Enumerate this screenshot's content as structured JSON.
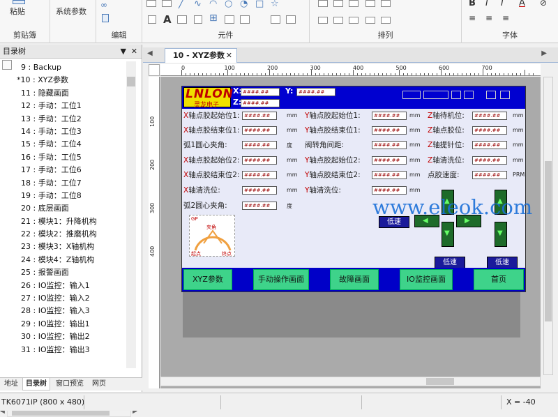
{
  "ribbon": {
    "paste_label": "粘贴",
    "clipboard_label": "剪贴簿",
    "system_params_label": "系统参数",
    "edit_label": "编辑",
    "elements_label": "元件",
    "arrange_label": "排列",
    "font_label": "字体",
    "text_tool": "A"
  },
  "tree_panel": {
    "title": "目录树",
    "items": [
      "9 : Backup",
      "*10 : XYZ参数",
      "11 : 隐藏画面",
      "12 : 手动：工位1",
      "13 : 手动：工位2",
      "14 : 手动：工位3",
      "15 : 手动：工位4",
      "16 : 手动：工位5",
      "17 : 手动：工位6",
      "18 : 手动：工位7",
      "19 : 手动：工位8",
      "20 : 底层画面",
      "21 : 模块1：升降机构",
      "22 : 模块2：推磨机构",
      "23 : 模块3：X轴机构",
      "24 : 模块4：Z轴机构",
      "25 : 报警画面",
      "26 : IO监控：输入1",
      "27 : IO监控：输入2",
      "28 : IO监控：输入3",
      "29 : IO监控：输出1",
      "30 : IO监控：输出2",
      "31 : IO监控：输出3"
    ],
    "bottom_tabs": [
      "地址",
      "目录树",
      "窗口预览",
      "网页"
    ]
  },
  "editor": {
    "tab_title": "10 - XYZ参数",
    "ruler_h": [
      "0",
      "100",
      "200",
      "300",
      "400",
      "500",
      "600",
      "700"
    ],
    "ruler_v": [
      "100",
      "200",
      "300",
      "400"
    ]
  },
  "hmi": {
    "logo": "LNLON",
    "logo_sub": "灵龙电子",
    "top_axes": [
      "X:",
      "Y:",
      "Z:"
    ],
    "field_value": "####.##",
    "rows_col1": [
      "X轴点胶起始位1:",
      "X轴点胶结束位1:",
      "弧1圆心夹角:",
      "X轴点胶起始位2:",
      "X轴点胶结束位2:",
      "X轴清洗位:",
      "弧2圆心夹角:"
    ],
    "rows_col2": [
      "Y轴点胶起始位1:",
      "Y轴点胶结束位1:",
      "阀转角间距:",
      "Y轴点胶起始位2:",
      "Y轴点胶结束位2:",
      "Y轴清洗位:"
    ],
    "rows_col3": [
      "Z轴待机位:",
      "Z轴点胶位:",
      "Z轴提针位:",
      "Z轴清洗位:",
      "点胶速度:"
    ],
    "unit_mm": "mm",
    "unit_deg": "度",
    "unit_rpm": "PRM",
    "slow_label": "低速",
    "gauge_top": "夹角",
    "gauge_left": "起点",
    "gauge_right": "终点",
    "gauge_label": "GP",
    "nav_buttons": [
      "XYZ参数",
      "手动操作画面",
      "故障画面",
      "IO监控画面",
      "首页"
    ]
  },
  "watermark": "www.eleok.com",
  "status": {
    "device": "TK6071iP (800 x 480)",
    "coord": "X = -40"
  },
  "colors": {
    "hmi_header": "#0000d0",
    "nav_button": "#3ed38a",
    "label_red": "#c00000",
    "logo_yellow": "#f0e000"
  }
}
